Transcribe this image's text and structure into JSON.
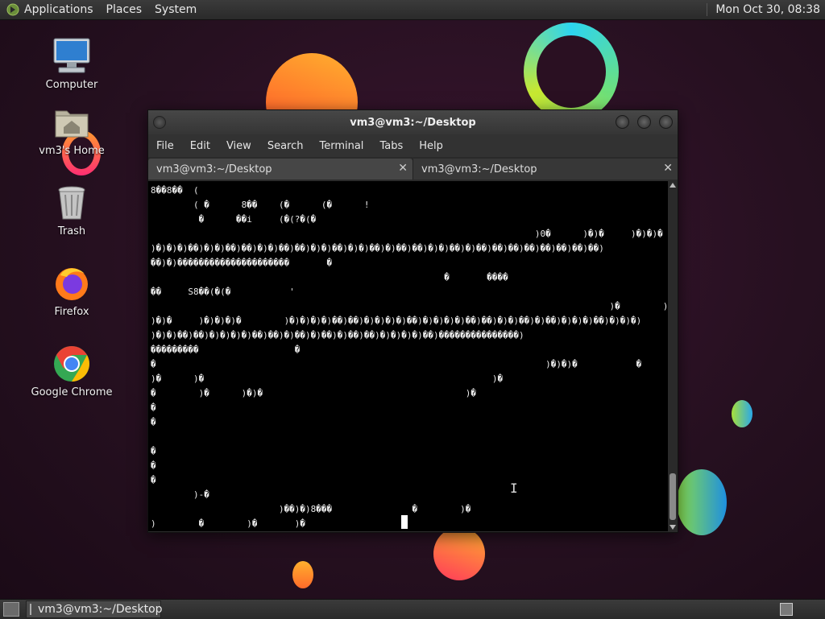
{
  "top_panel": {
    "menus": [
      "Applications",
      "Places",
      "System"
    ],
    "clock": "Mon Oct 30, 08:38"
  },
  "desktop": {
    "icons": [
      {
        "label": "Computer",
        "icon": "computer-icon"
      },
      {
        "label": "vm3's Home",
        "icon": "home-folder-icon"
      },
      {
        "label": "Trash",
        "icon": "trash-icon"
      },
      {
        "label": "Firefox",
        "icon": "firefox-icon"
      },
      {
        "label": "Google Chrome",
        "icon": "chrome-icon"
      }
    ]
  },
  "terminal": {
    "title": "vm3@vm3:~/Desktop",
    "menu": [
      "File",
      "Edit",
      "View",
      "Search",
      "Terminal",
      "Tabs",
      "Help"
    ],
    "tabs": [
      {
        "label": "vm3@vm3:~/Desktop",
        "active": true
      },
      {
        "label": "vm3@vm3:~/Desktop",
        "active": false
      }
    ],
    "output": "8��8��  (\n        ( �      8��    (�      (�      !\n         �      ��i     (�(?�(�\n                                                                        )0�      )�)�     )�)�)�\n)�)�)�)��)�)�)��)��)�)�)��)��)�)�)��)�)�)��)�)��)��)�)�)��)�)��)��)��)��)��)��)��)��)\n��)�)���������������������       �\n                                                       �       ����\n��     S8��(�(�           '\n                                                                                      )�        )\n)�)�     )�)�)�)�        )�)�)�)�)��)��)�)�)�)�)��)�)�)�)�)��)��)�)�)��)�)��)�)�)�)��)�)�)�)\n)�)�)��)��)�)�)�)�)��)��)�)��)�)��)�)��)��)�)�)�)�)��)���������������)\n���������                  �                                                                      )\n�                                                                         )�)�)�           �        )\n)�      )�                                                      )�                                    )\n�        )�      )�)�                                      )�                                    )\n�                                                                                                      )\n�\n                                                                                                 )�      )\n�                                                                                                )�      )\n�                                                                                                      )\n�\n        )-�\n                        )��)�)8���               �        )�\n)        �        )�       )�"
  },
  "taskbar": {
    "task_label": "vm3@vm3:~/Desktop"
  }
}
